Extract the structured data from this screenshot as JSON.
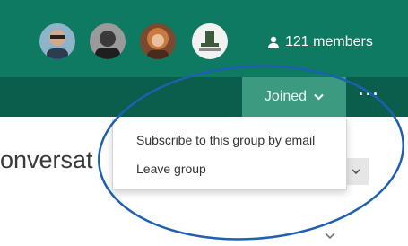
{
  "header": {
    "avatars": [
      {
        "name": "member-avatar-1",
        "color": "#c99a7a"
      },
      {
        "name": "member-avatar-2",
        "color": "#6a6a6a"
      },
      {
        "name": "member-avatar-3",
        "color": "#b5643a"
      },
      {
        "name": "member-avatar-4",
        "color": "#e8e8e8"
      }
    ],
    "members_icon": "person-icon",
    "members_label": "121 members",
    "joined_label": "Joined",
    "more_label": "···"
  },
  "main": {
    "title_fragment": "onversat"
  },
  "dropdown": {
    "items": [
      {
        "label": "Subscribe to this group by email"
      },
      {
        "label": "Leave group"
      }
    ]
  },
  "colors": {
    "header": "#0e7a62",
    "subbar": "#0b5e4b",
    "joined_button": "#3c9a80",
    "annotation_circle": "#1f5fb0"
  }
}
